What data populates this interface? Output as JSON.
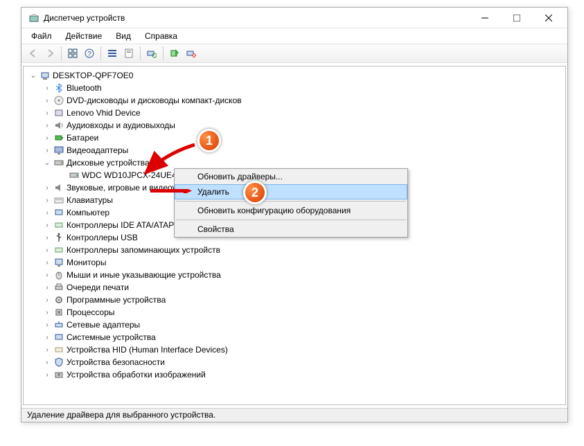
{
  "window": {
    "title": "Диспетчер устройств"
  },
  "menu": {
    "file": "Файл",
    "action": "Действие",
    "view": "Вид",
    "help": "Справка"
  },
  "root": "DESKTOP-QPF7OE0",
  "cats": {
    "bluetooth": "Bluetooth",
    "dvd": "DVD-дисководы и дисководы компакт-дисков",
    "lenovo": "Lenovo Vhid Device",
    "audio": "Аудиовходы и аудиовыходы",
    "battery": "Батареи",
    "video": "Видеоадаптеры",
    "disk": "Дисковые устройства",
    "wdc": "WDC WD10JPCX-24UE4T0",
    "sound": "Звуковые, игровые и видеоустройства",
    "keyboard": "Клавиатуры",
    "computer": "Компьютер",
    "ide": "Контроллеры IDE ATA/ATAPI",
    "usb": "Контроллеры USB",
    "storage": "Контроллеры запоминающих устройств",
    "monitor": "Мониторы",
    "mouse": "Мыши и иные указывающие устройства",
    "printq": "Очереди печати",
    "software": "Программные устройства",
    "cpu": "Процессоры",
    "net": "Сетевые адаптеры",
    "sys": "Системные устройства",
    "hid": "Устройства HID (Human Interface Devices)",
    "security": "Устройства безопасности",
    "imaging": "Устройства обработки изображений"
  },
  "context": {
    "update": "Обновить драйверы...",
    "delete": "Удалить",
    "refresh": "Обновить конфигурацию оборудования",
    "props": "Свойства"
  },
  "status": "Удаление драйвера для выбранного устройства.",
  "callouts": {
    "one": "1",
    "two": "2"
  }
}
